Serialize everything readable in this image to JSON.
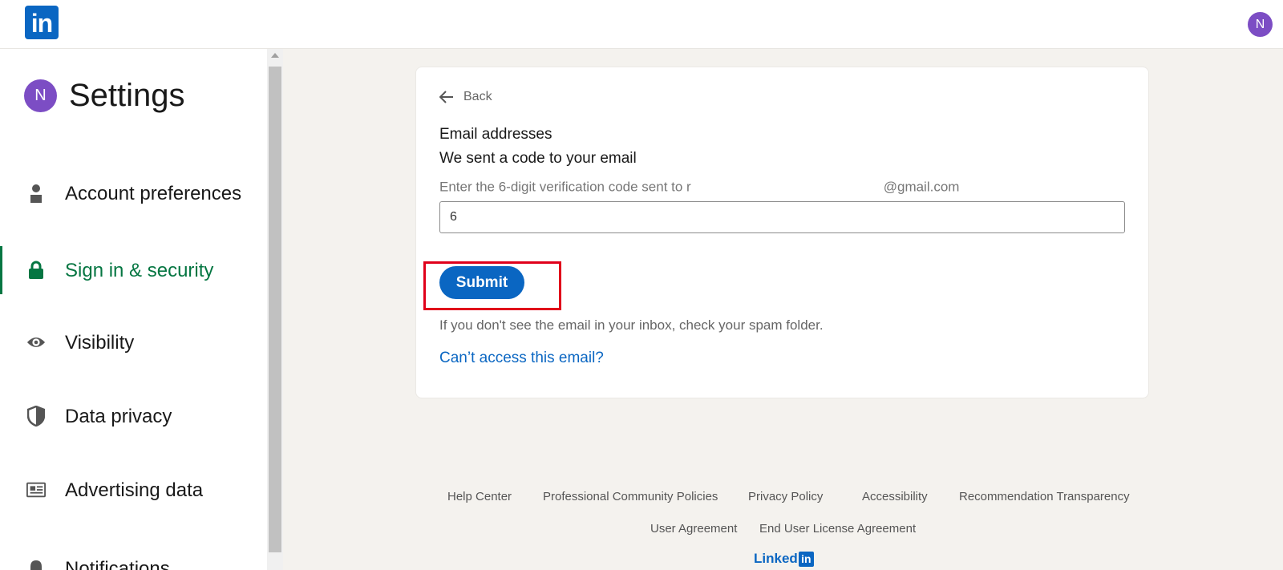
{
  "header": {
    "logo_text": "in",
    "avatar_initial": "N"
  },
  "sidebar": {
    "avatar_initial": "N",
    "title": "Settings",
    "items": [
      {
        "label": "Account preferences",
        "icon": "person-icon",
        "active": false
      },
      {
        "label": "Sign in & security",
        "icon": "lock-icon",
        "active": true
      },
      {
        "label": "Visibility",
        "icon": "eye-icon",
        "active": false
      },
      {
        "label": "Data privacy",
        "icon": "shield-icon",
        "active": false
      },
      {
        "label": "Advertising data",
        "icon": "newspaper-icon",
        "active": false
      },
      {
        "label": "Notifications",
        "icon": "bell-icon",
        "active": false
      }
    ]
  },
  "card": {
    "back_label": "Back",
    "section_label": "Email addresses",
    "heading": "We sent a code to your email",
    "instructions_prefix": "Enter the 6-digit verification code sent to r",
    "instructions_suffix": "@gmail.com",
    "code_value": "6",
    "submit_label": "Submit",
    "spam_note": "If you don't see the email in your inbox, check your spam folder.",
    "cant_access_label": "Can’t access this email?"
  },
  "footer": {
    "links_row1": [
      "Help Center",
      "Professional Community Policies",
      "Privacy Policy",
      "Accessibility",
      "Recommendation Transparency"
    ],
    "links_row2": [
      "User Agreement",
      "End User License Agreement"
    ],
    "brand_text": "Linked",
    "brand_box": "in"
  },
  "colors": {
    "brand_blue": "#0a66c2",
    "active_green": "#057642",
    "highlight_red": "#e0001a",
    "avatar_purple": "#7c4dc4"
  }
}
